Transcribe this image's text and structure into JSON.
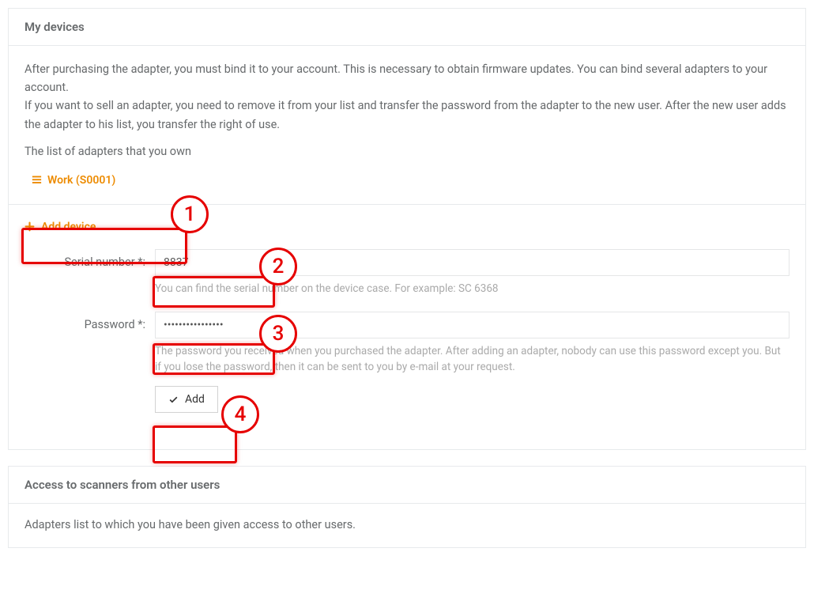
{
  "panel1": {
    "title": "My devices",
    "intro": "After purchasing the adapter, you must bind it to your account. This is necessary to obtain firmware updates. You can bind several adapters to your account.\nIf you want to sell an adapter, you need to remove it from your list and transfer the password from the adapter to the new user. After the new user adds the adapter to his list, you transfer the right of use.",
    "list_label": "The list of adapters that you own",
    "device_name": "Work (S0001)",
    "add_device_label": "Add device",
    "serial": {
      "label": "Serial number *:",
      "value": "8837",
      "hint": "You can find the serial number on the device case. For example: SC 6368"
    },
    "password": {
      "label": "Password *:",
      "value": "••••••••••••••••",
      "hint": "The password you received when you purchased the adapter. After adding an adapter, nobody can use this password except you. But if you lose the password, then it can be sent to you by e-mail at your request."
    },
    "add_button_label": "Add"
  },
  "panel2": {
    "title": "Access to scanners from other users",
    "body": "Adapters list to which you have been given access to other users."
  },
  "annotations": {
    "1": "1",
    "2": "2",
    "3": "3",
    "4": "4"
  }
}
